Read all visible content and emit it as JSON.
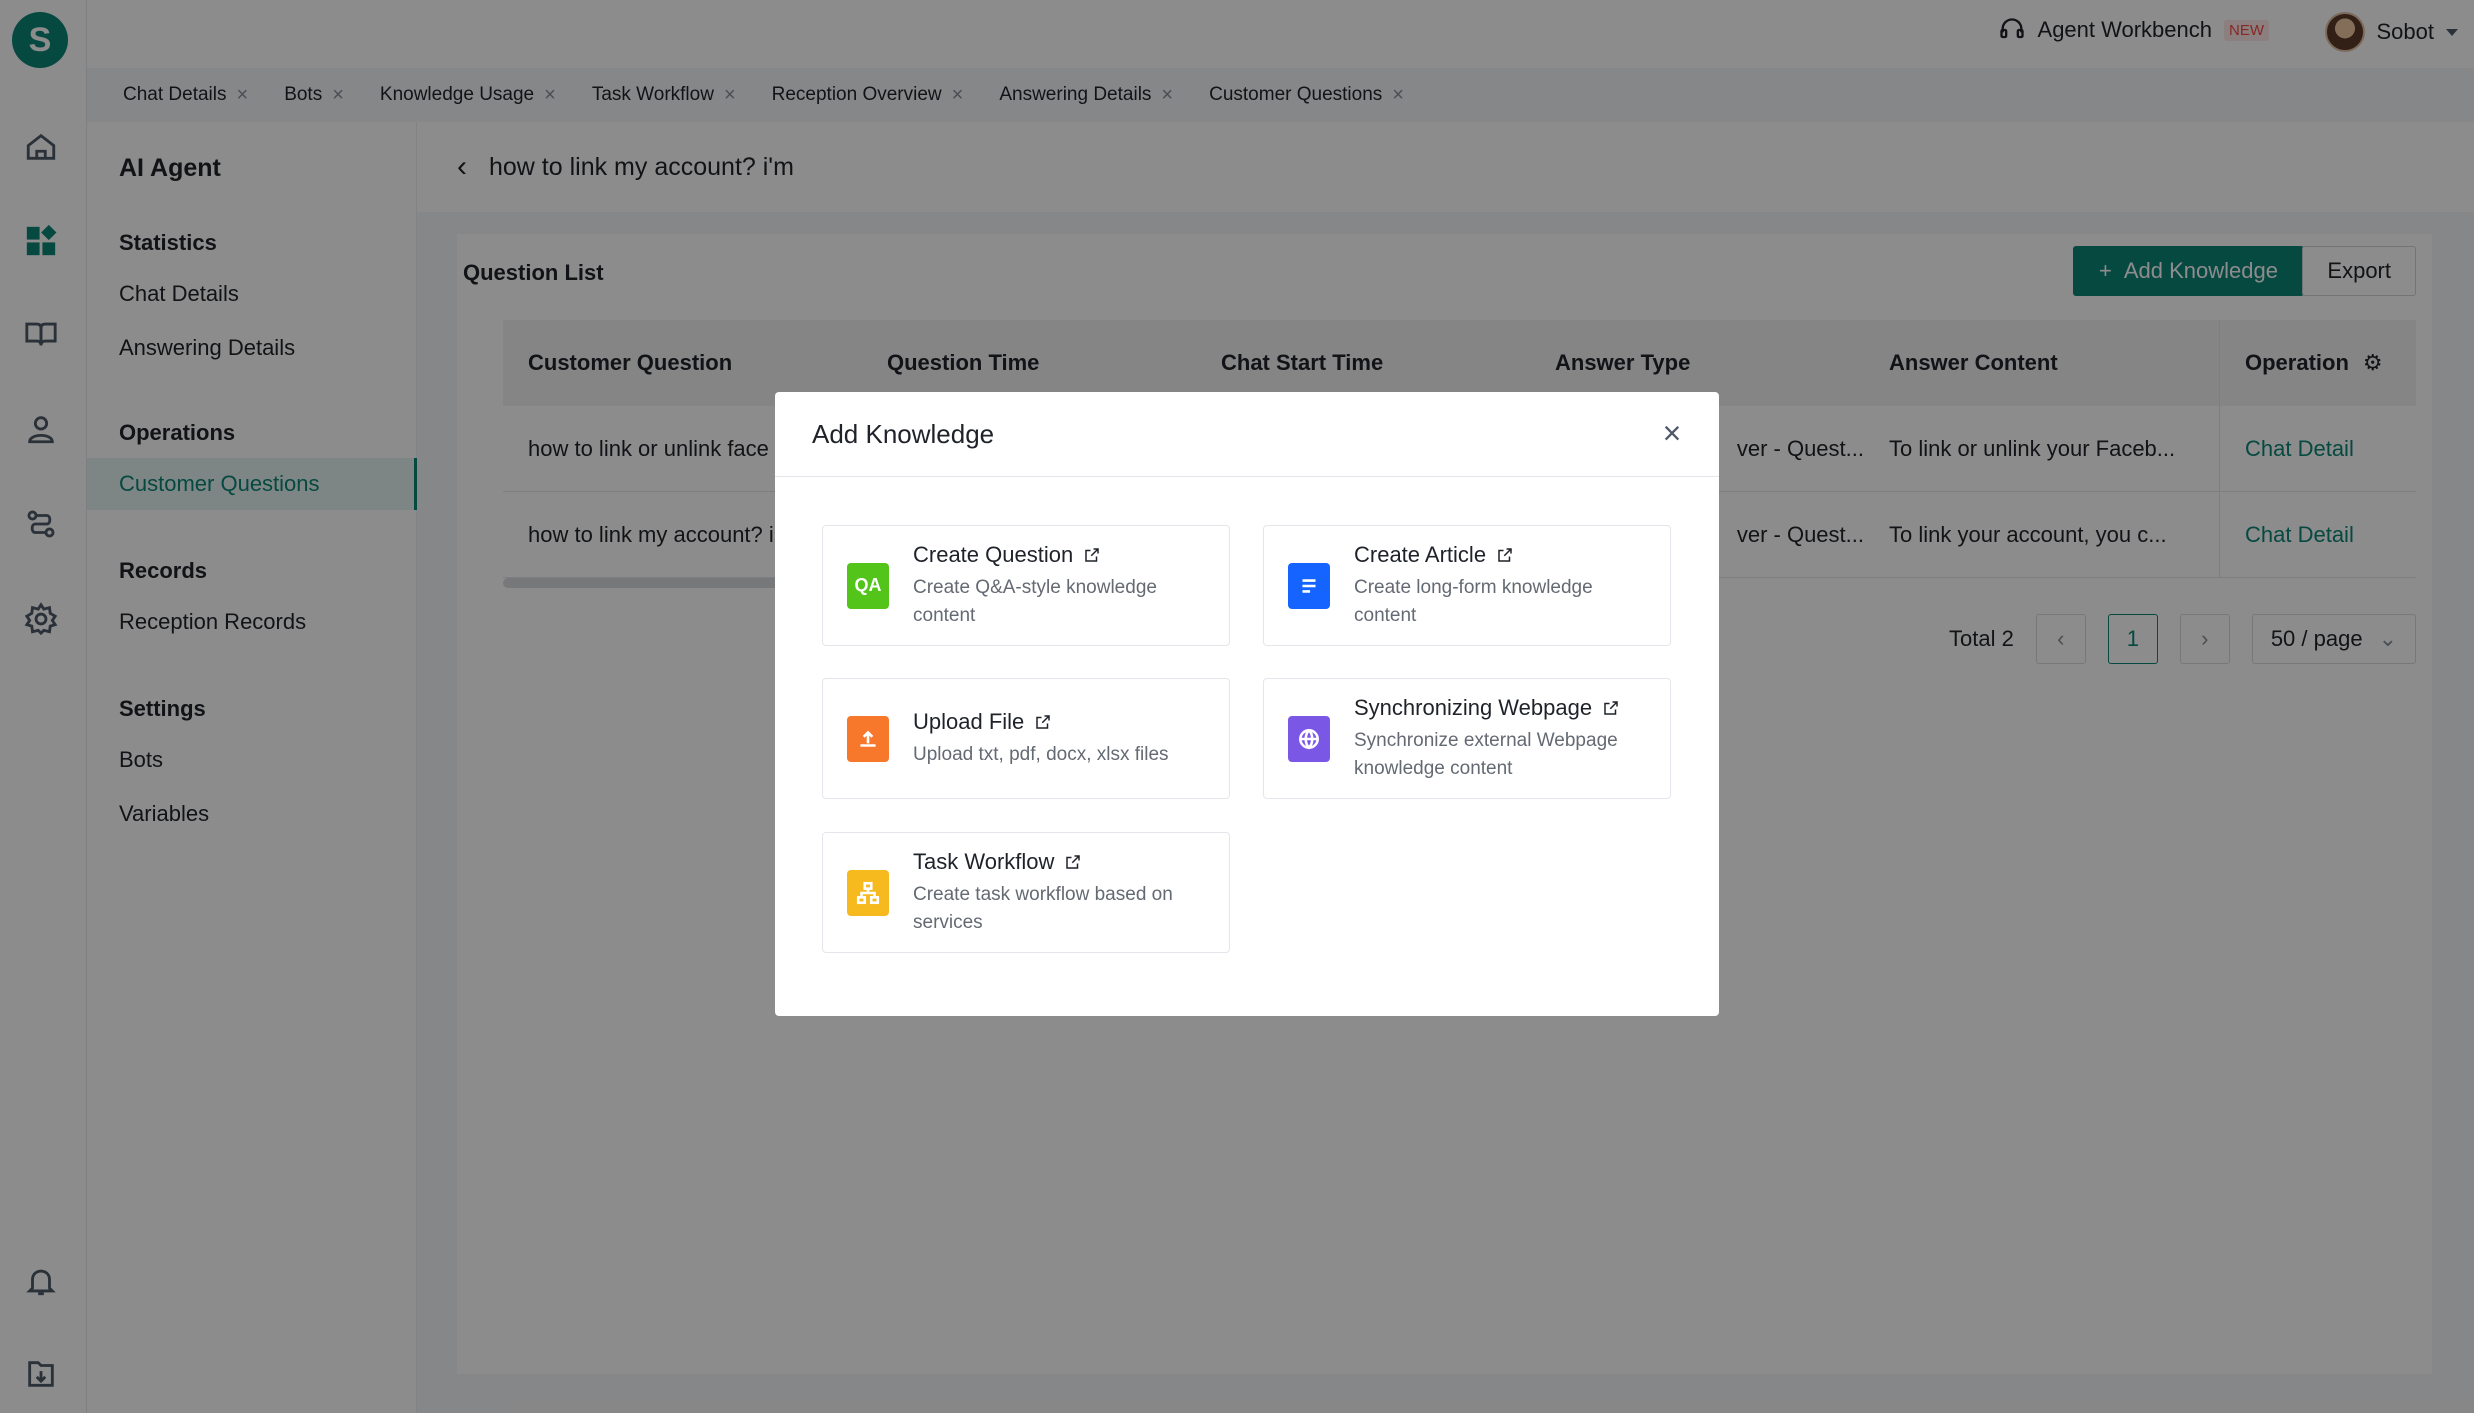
{
  "app": {
    "logo_letter": "S"
  },
  "topbar": {
    "workbench_label": "Agent Workbench",
    "new_badge": "NEW",
    "user_name": "Sobot"
  },
  "tabs": [
    {
      "label": "Chat Details"
    },
    {
      "label": "Bots"
    },
    {
      "label": "Knowledge Usage"
    },
    {
      "label": "Task Workflow"
    },
    {
      "label": "Reception Overview"
    },
    {
      "label": "Answering Details"
    },
    {
      "label": "Customer Questions"
    }
  ],
  "sidebar": {
    "title": "AI Agent",
    "groups": {
      "statistics": "Statistics",
      "operations": "Operations",
      "records": "Records",
      "settings": "Settings"
    },
    "items": {
      "chat_details": "Chat Details",
      "answering_details": "Answering Details",
      "customer_questions": "Customer Questions",
      "reception_records": "Reception Records",
      "bots": "Bots",
      "variables": "Variables"
    }
  },
  "page": {
    "title": "how to link my account? i'm",
    "section_title": "Question List",
    "add_knowledge_label": "Add Knowledge",
    "export_label": "Export"
  },
  "table": {
    "columns": [
      "Customer Question",
      "Question Time",
      "Chat Start Time",
      "Answer Type",
      "Answer Content",
      "Operation"
    ],
    "rows": [
      {
        "question": "how to link or unlink face",
        "answer_type": "ver - Quest...",
        "answer_content": "To link or unlink your Faceb...",
        "operation": "Chat Detail"
      },
      {
        "question": "how to link my account? i",
        "answer_type": "ver - Quest...",
        "answer_content": "To link your account, you c...",
        "operation": "Chat Detail"
      }
    ]
  },
  "pagination": {
    "total_label": "Total 2",
    "current_page": "1",
    "page_size": "50 / page"
  },
  "modal": {
    "title": "Add Knowledge",
    "options": [
      {
        "title": "Create Question",
        "desc": "Create Q&A-style knowledge content",
        "icon_text": "QA",
        "color": "#52c41a"
      },
      {
        "title": "Create Article",
        "desc": "Create long-form knowledge content",
        "color": "#1664ff"
      },
      {
        "title": "Upload File",
        "desc": "Upload txt, pdf, docx, xlsx files",
        "color": "#f7772b"
      },
      {
        "title": "Synchronizing Webpage",
        "desc": "Synchronize external Webpage knowledge content",
        "color": "#7b57e6"
      },
      {
        "title": "Task Workflow",
        "desc": "Create task workflow based on services",
        "color": "#f7ba1e"
      }
    ]
  }
}
